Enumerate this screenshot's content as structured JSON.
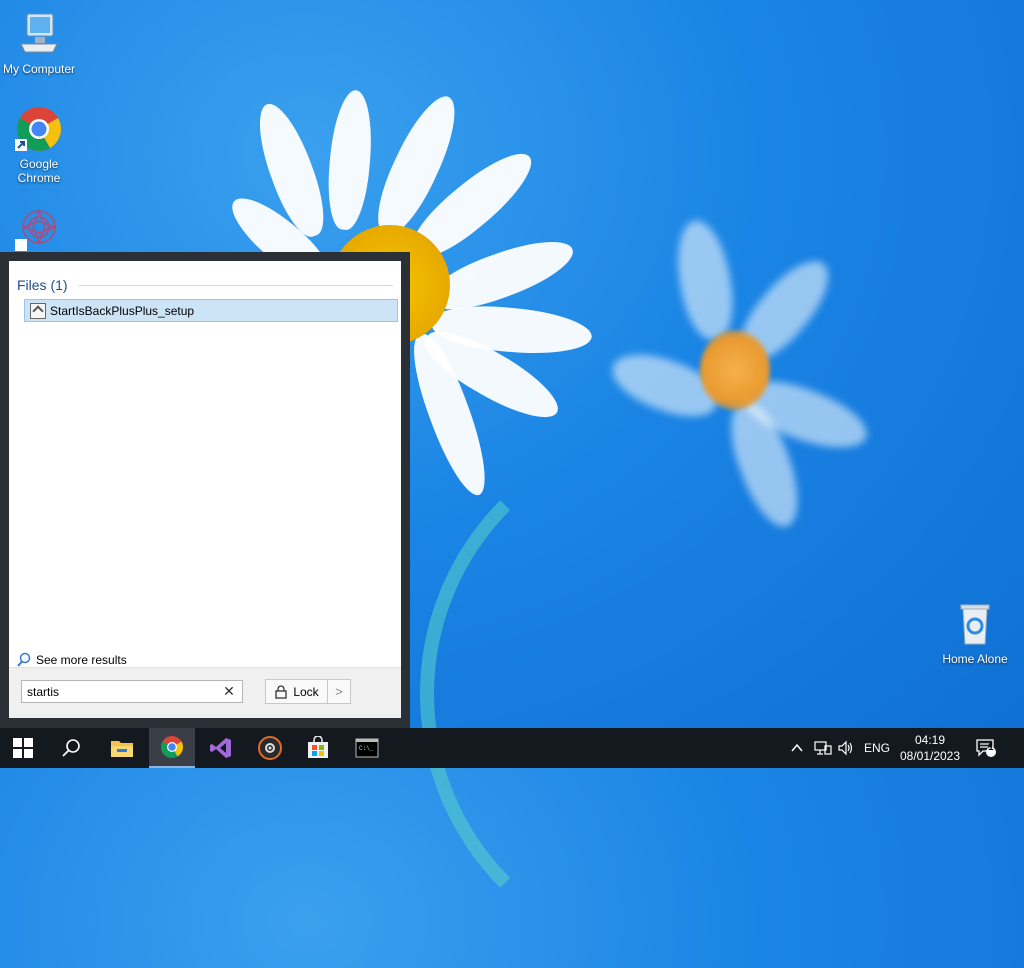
{
  "desktop": {
    "icons": [
      {
        "label": "My Computer",
        "icon": "computer-icon"
      },
      {
        "label": "Google\nChrome",
        "icon": "chrome-icon"
      },
      {
        "label": "",
        "icon": "flower-app-icon"
      },
      {
        "label": "Home Alone",
        "icon": "recycle-bin-icon"
      }
    ]
  },
  "start_menu": {
    "files_header": "Files (1)",
    "results": [
      {
        "label": "StartIsBackPlusPlus_setup",
        "icon": "setup-file-icon"
      }
    ],
    "see_more": "See more results",
    "search": {
      "value": "startis",
      "placeholder": ""
    },
    "lock_label": "Lock"
  },
  "taskbar": {
    "apps": [
      {
        "name": "start",
        "icon": "windows-logo-icon"
      },
      {
        "name": "search",
        "icon": "search-icon"
      },
      {
        "name": "file-explorer",
        "icon": "folder-icon"
      },
      {
        "name": "chrome",
        "icon": "chrome-icon"
      },
      {
        "name": "visual-studio",
        "icon": "visual-studio-icon"
      },
      {
        "name": "media-player",
        "icon": "disc-icon"
      },
      {
        "name": "store",
        "icon": "store-icon"
      },
      {
        "name": "terminal",
        "icon": "terminal-icon"
      }
    ],
    "tray": {
      "language": "ENG",
      "time": "04:19",
      "date": "08/01/2023",
      "notification_count": "1"
    }
  },
  "colors": {
    "accent": "#1a84e4",
    "selection": "#cde4f7",
    "taskbar": "#14181f"
  }
}
